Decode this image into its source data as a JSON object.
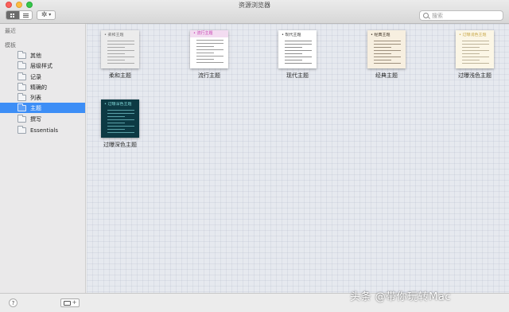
{
  "window": {
    "title": "资源浏览器"
  },
  "toolbar": {
    "view_grid_icon": "grid-view-icon",
    "view_list_icon": "list-view-icon",
    "action_icon": "gear-icon",
    "search": {
      "placeholder": "搜索"
    }
  },
  "sidebar": {
    "recent_header": "最近",
    "templates_header": "模板",
    "items": [
      {
        "label": "其他"
      },
      {
        "label": "层级样式"
      },
      {
        "label": "记录"
      },
      {
        "label": "精确的"
      },
      {
        "label": "列表"
      },
      {
        "label": "主题",
        "selected": true
      },
      {
        "label": "撰写"
      },
      {
        "label": "Essentials"
      }
    ],
    "accent_color": "#3d8ef6"
  },
  "themes": [
    {
      "name": "柔和主题",
      "thumb_title": "柔和主题",
      "bg": "#ececec",
      "title_color": "#6b6b6b",
      "line_color": "#a9a9a9"
    },
    {
      "name": "流行主题",
      "thumb_title": "流行主题",
      "bg": "#ffffff",
      "header_bg": "#f3dcf1",
      "title_color": "#c63fb0",
      "line_color": "#9c9c9c"
    },
    {
      "name": "现代主题",
      "thumb_title": "现代主题",
      "bg": "#ffffff",
      "title_color": "#333333",
      "line_color": "#8f8f8f"
    },
    {
      "name": "经典主题",
      "thumb_title": "经典主题",
      "bg": "#f7efe0",
      "title_color": "#3a2e20",
      "line_color": "#9d8f7c"
    },
    {
      "name": "过曝浅色主题",
      "thumb_title": "过曝浅色主题",
      "bg": "#fbf6e6",
      "title_color": "#c9a84a",
      "line_color": "#bfb59b"
    },
    {
      "name": "过曝深色主题",
      "thumb_title": "过曝深色主题",
      "bg": "#0d3a44",
      "title_color": "#7fd6d6",
      "line_color": "#5aa1a8"
    }
  ],
  "bottom": {
    "help_label": "?",
    "add_label": "+"
  },
  "watermark": "头条 @带你玩转Mac"
}
